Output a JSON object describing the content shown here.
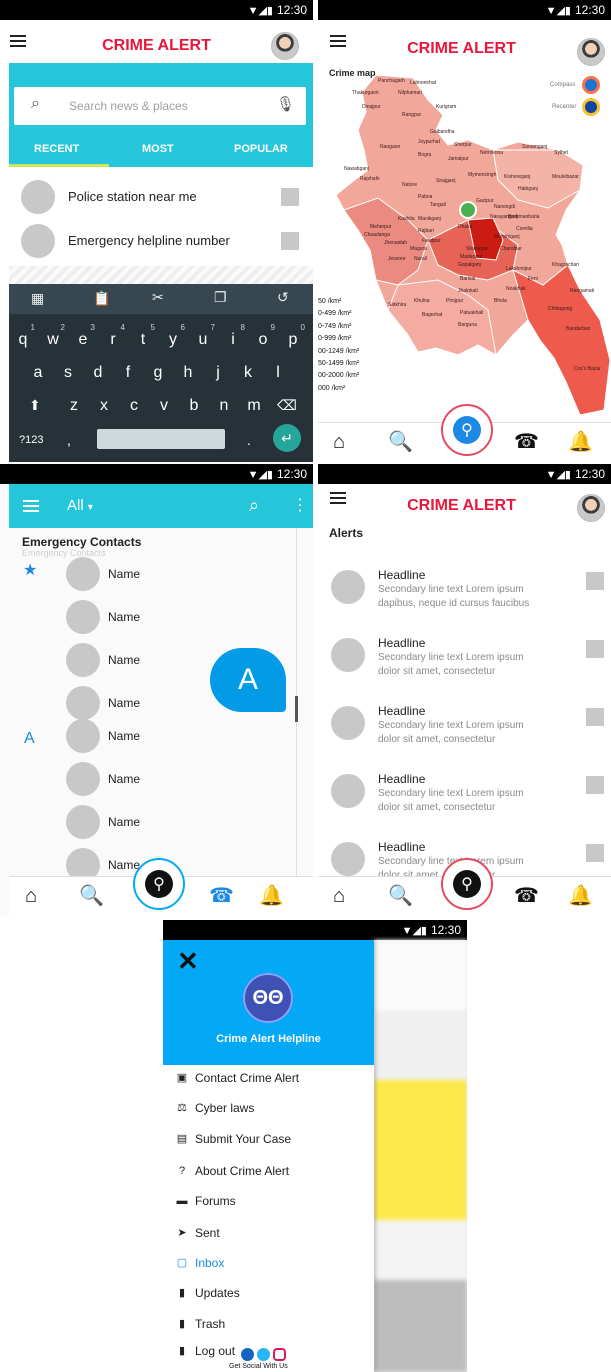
{
  "status_time": "12:30",
  "app_title": "CRIME ALERT",
  "search": {
    "placeholder": "Search news & places",
    "tabs": [
      "RECENT",
      "MOST",
      "POPULAR"
    ],
    "suggestions": [
      "Police station near me",
      "Emergency helpline number"
    ]
  },
  "keyboard": {
    "row1": [
      "q",
      "w",
      "e",
      "r",
      "t",
      "y",
      "u",
      "i",
      "o",
      "p"
    ],
    "row1_nums": [
      "1",
      "2",
      "3",
      "4",
      "5",
      "6",
      "7",
      "8",
      "9",
      "0"
    ],
    "row2": [
      "a",
      "s",
      "d",
      "f",
      "g",
      "h",
      "j",
      "k",
      "l"
    ],
    "row3": [
      "z",
      "x",
      "c",
      "v",
      "b",
      "n",
      "m"
    ],
    "sym_key": "?123",
    "comma": ",",
    "period": "."
  },
  "map": {
    "title": "Crime map",
    "compass_label": "Compass",
    "recenter_label": "Recenter",
    "legend": [
      "50 /km²",
      "0-499 /km²",
      "0-749 /km²",
      "0-999 /km²",
      "00-1249 /km²",
      "50-1499 /km²",
      "00-2000 /km²",
      "000 /km²"
    ],
    "places": [
      "Panchagarh",
      "Thakurgaon",
      "Nilphamari",
      "Lalmonirhat",
      "Kurigram",
      "Dinajpur",
      "Rangpur",
      "Gaibandha",
      "Joypurhat",
      "Naogaon",
      "Bogra",
      "Sherpur",
      "Netrokona",
      "Sunamganj",
      "Sylhet",
      "Nawabganj",
      "Jamalpur",
      "Rajshahi",
      "Natore",
      "Sirajganj",
      "Mymensingh",
      "Kishoreganj",
      "Moulvibazar",
      "Habiganj",
      "Pabna",
      "Tangail",
      "Gazipur",
      "Narsingdi",
      "Brahmanbaria",
      "Kushtia",
      "Manikganj",
      "Meherpur",
      "Rajbari",
      "Dhaka",
      "Narayanganj",
      "Chuadanga",
      "Jhenaidah",
      "Faridpur",
      "Munshiganj",
      "Comilla",
      "Magura",
      "Shariatpur",
      "Chandpur",
      "Jessore",
      "Narail",
      "Madaripur",
      "Khagrachari",
      "Gopalganj",
      "Lakshmipur",
      "Feni",
      "Barisal",
      "Noakhali",
      "Rangamati",
      "Jhalokati",
      "Satkhira",
      "Khulna",
      "Pirojpur",
      "Bhola",
      "Chittagong",
      "Bagerhat",
      "Patuakhali",
      "Barguna",
      "Bandarban",
      "Cox's Bazar"
    ]
  },
  "contacts": {
    "filter_label": "All",
    "section_title": "Emergency Contacts",
    "section_subtitle": "Emergency Contacts",
    "name_placeholder": "Name",
    "index_letter": "A",
    "bubble_letter": "A"
  },
  "alerts": {
    "section_title": "Alerts",
    "items": [
      {
        "headline": "Headline",
        "line1": "Secondary line text Lorem ipsum",
        "line2": "dapibus, neque id cursus faucibus"
      },
      {
        "headline": "Headline",
        "line1": "Secondary line text Lorem ipsum",
        "line2": "dolor sit amet, consectetur"
      },
      {
        "headline": "Headline",
        "line1": "Secondary line text Lorem ipsum",
        "line2": "dolor sit amet, consectetur"
      },
      {
        "headline": "Headline",
        "line1": "Secondary line text Lorem ipsum",
        "line2": "dolor sit amet, consectetur"
      },
      {
        "headline": "Headline",
        "line1": "Secondary line text Lorem ipsum",
        "line2": "dolor sit amet, consectetur"
      }
    ]
  },
  "drawer": {
    "title": "Crime Alert Helpline",
    "items": [
      "Contact Crime Alert",
      "Cyber laws",
      "Submit Your Case",
      "About Crime Alert",
      "Forums",
      "Sent",
      "Inbox",
      "Updates",
      "Trash",
      "Log out"
    ],
    "footer": "Get Social With Us"
  },
  "colors": {
    "accent": "#e8173b",
    "primary": "#26c6da",
    "blue": "#03a9f4",
    "drawer_header": "#03a9f4"
  }
}
